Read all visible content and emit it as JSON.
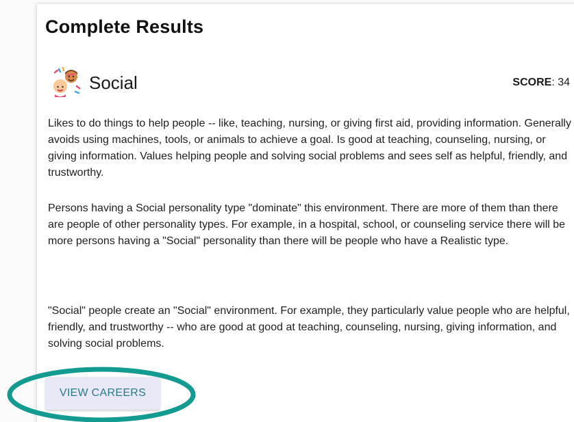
{
  "results": {
    "title": "Complete Results",
    "type": {
      "icon": "people-emoji-icon",
      "name": "Social",
      "score_label": "SCORE",
      "score_value": ": 34"
    },
    "paragraphs": [
      "Likes to do things to help people -- like, teaching, nursing, or giving first aid, providing information. Generally avoids using machines, tools, or animals to achieve a goal. Is good at teaching, counseling, nursing, or giving information. Values helping people and solving social problems and sees self as helpful, friendly, and trustworthy.",
      "Persons having a Social personality type \"dominate\" this environment. There are more of them than there are people of other personality types. For example, in a hospital, school, or counseling service there will be more persons having a \"Social\" personality than there will be people who have a Realistic type.",
      "\"Social\" people create an \"Social\" environment. For example, they particularly value people who are helpful, friendly, and trustworthy -- who are good at good at teaching, counseling, nursing, giving information, and solving social problems."
    ],
    "button_label": "VIEW CAREERS"
  },
  "colors": {
    "button_bg": "#e8e8f6",
    "button_text": "#2a7a86",
    "highlight_ring": "#139b92"
  }
}
